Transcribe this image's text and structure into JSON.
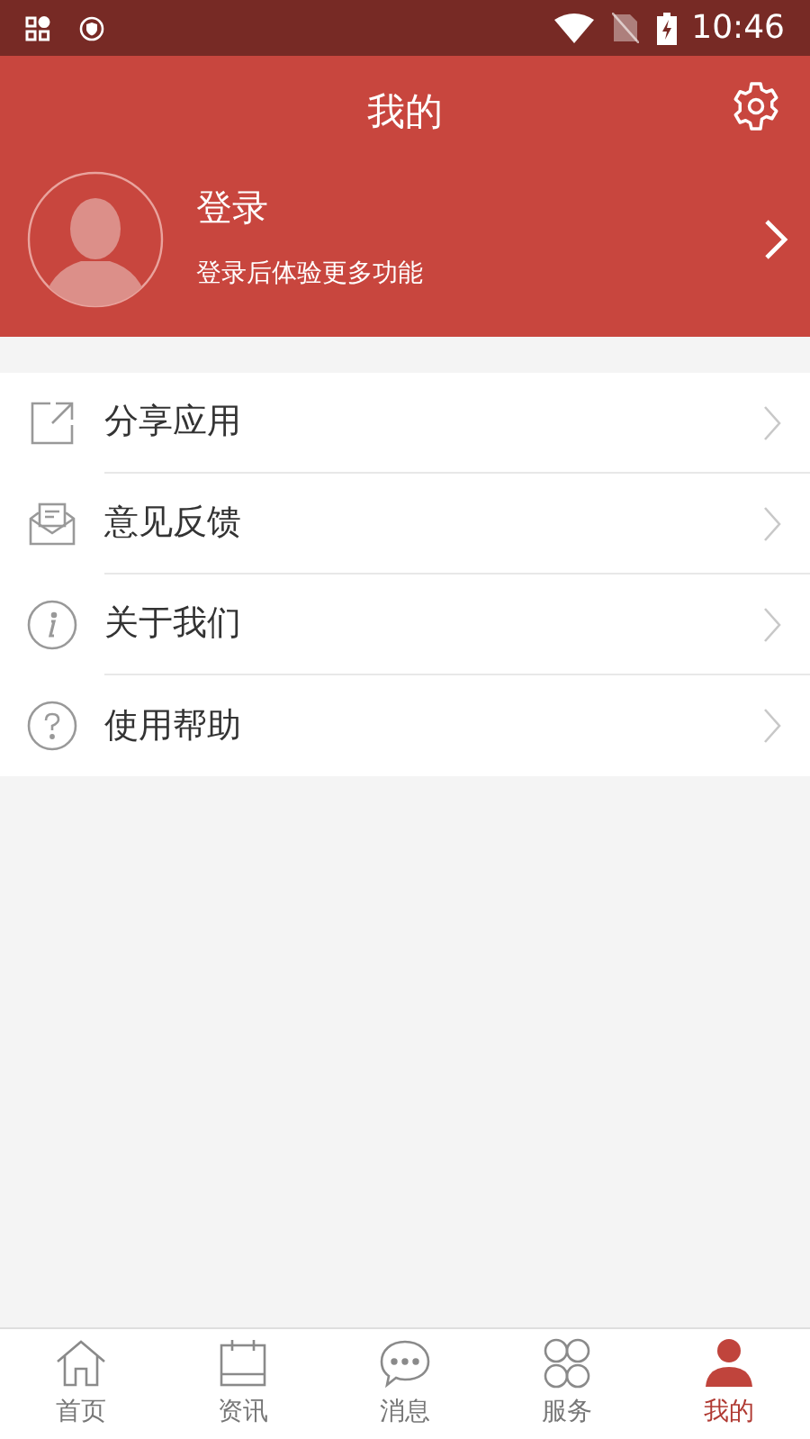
{
  "status_bar": {
    "time": "10:46"
  },
  "header": {
    "title": "我的"
  },
  "profile": {
    "name": "登录",
    "subtitle": "登录后体验更多功能"
  },
  "menu": [
    {
      "kind": "share",
      "label": "分享应用"
    },
    {
      "kind": "feedback",
      "label": "意见反馈"
    },
    {
      "kind": "info",
      "label": "关于我们"
    },
    {
      "kind": "help",
      "label": "使用帮助"
    }
  ],
  "tabs": [
    {
      "kind": "home",
      "label": "首页",
      "selected": false
    },
    {
      "kind": "news",
      "label": "资讯",
      "selected": false
    },
    {
      "kind": "message",
      "label": "消息",
      "selected": false
    },
    {
      "kind": "service",
      "label": "服务",
      "selected": false
    },
    {
      "kind": "me",
      "label": "我的",
      "selected": true
    }
  ]
}
